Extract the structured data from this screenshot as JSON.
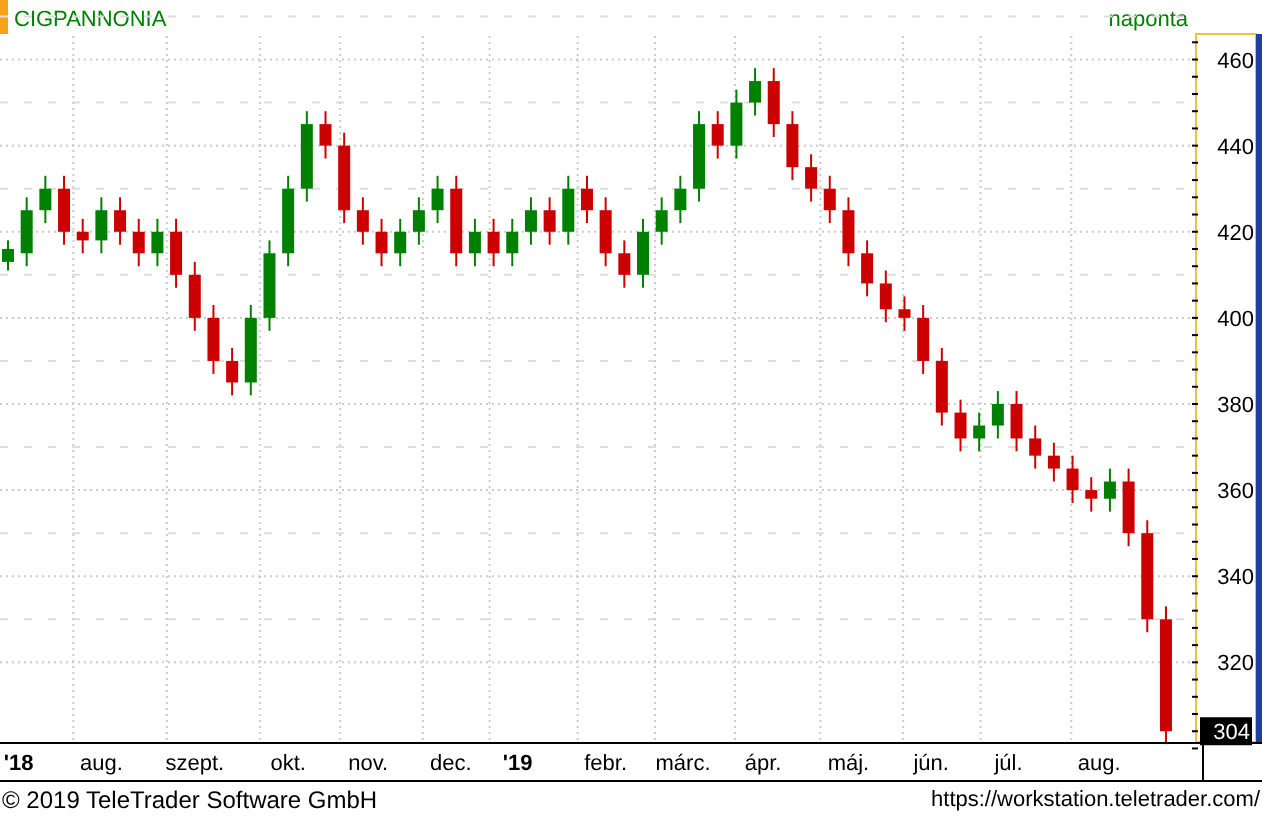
{
  "title": "CIGPANNONIA",
  "interval": "naponta",
  "chart_data": {
    "type": "candlestick",
    "grid": true,
    "xlim": [
      "2018-07-04",
      "2019-10-20"
    ],
    "ylim": [
      301.5,
      465
    ],
    "yticks": [
      {
        "value": 320,
        "label": "320"
      },
      {
        "value": 340,
        "label": "340"
      },
      {
        "value": 360,
        "label": "360"
      },
      {
        "value": 380,
        "label": "380"
      },
      {
        "value": 400,
        "label": "400"
      },
      {
        "value": 420,
        "label": "420"
      },
      {
        "value": 440,
        "label": "440"
      },
      {
        "value": 460,
        "label": "460"
      }
    ],
    "xticks": [
      {
        "value": "2018-07-11",
        "label": "'18"
      },
      {
        "value": "2018-08-11",
        "label": "aug."
      },
      {
        "value": "2018-09-15",
        "label": "szept."
      },
      {
        "value": "2018-10-20",
        "label": "okt."
      },
      {
        "value": "2018-11-19",
        "label": "nov."
      },
      {
        "value": "2018-12-20",
        "label": "dec."
      },
      {
        "value": "2019-01-14",
        "label": "'19"
      },
      {
        "value": "2019-02-16",
        "label": "febr."
      },
      {
        "value": "2019-03-17",
        "label": "márc."
      },
      {
        "value": "2019-04-16",
        "label": "ápr."
      },
      {
        "value": "2019-05-18",
        "label": "máj."
      },
      {
        "value": "2019-06-18",
        "label": "jún."
      },
      {
        "value": "2019-07-17",
        "label": "júl."
      },
      {
        "value": "2019-08-20",
        "label": "aug."
      }
    ],
    "x": [
      "2018-07-07",
      "2018-07-14",
      "2018-07-21",
      "2018-07-28",
      "2018-08-04",
      "2018-08-11",
      "2018-08-18",
      "2018-08-25",
      "2018-09-01",
      "2018-09-08",
      "2018-09-15",
      "2018-09-22",
      "2018-09-29",
      "2018-10-06",
      "2018-10-13",
      "2018-10-20",
      "2018-10-27",
      "2018-11-03",
      "2018-11-10",
      "2018-11-17",
      "2018-11-24",
      "2018-12-01",
      "2018-12-08",
      "2018-12-15",
      "2018-12-22",
      "2018-12-29",
      "2019-01-05",
      "2019-01-12",
      "2019-01-19",
      "2019-01-26",
      "2019-02-02",
      "2019-02-09",
      "2019-02-16",
      "2019-02-23",
      "2019-03-02",
      "2019-03-09",
      "2019-03-16",
      "2019-03-23",
      "2019-03-30",
      "2019-04-06",
      "2019-04-13",
      "2019-04-20",
      "2019-04-27",
      "2019-05-04",
      "2019-05-11",
      "2019-05-18",
      "2019-05-25",
      "2019-06-01",
      "2019-06-08",
      "2019-06-15",
      "2019-06-22",
      "2019-06-29",
      "2019-07-06",
      "2019-07-13",
      "2019-07-20",
      "2019-07-27",
      "2019-08-03",
      "2019-08-10",
      "2019-08-17",
      "2019-08-24",
      "2019-08-31",
      "2019-09-07",
      "2019-09-14"
    ],
    "ohlc": [
      [
        413,
        418,
        411,
        416
      ],
      [
        415,
        428,
        412,
        425
      ],
      [
        425,
        433,
        422,
        430
      ],
      [
        430,
        433,
        417,
        420
      ],
      [
        420,
        423,
        415,
        418
      ],
      [
        418,
        428,
        415,
        425
      ],
      [
        425,
        428,
        417,
        420
      ],
      [
        420,
        423,
        412,
        415
      ],
      [
        415,
        423,
        412,
        420
      ],
      [
        420,
        423,
        407,
        410
      ],
      [
        410,
        413,
        397,
        400
      ],
      [
        400,
        403,
        387,
        390
      ],
      [
        390,
        393,
        382,
        385
      ],
      [
        385,
        403,
        382,
        400
      ],
      [
        400,
        418,
        397,
        415
      ],
      [
        415,
        433,
        412,
        430
      ],
      [
        430,
        448,
        427,
        445
      ],
      [
        445,
        448,
        437,
        440
      ],
      [
        440,
        443,
        422,
        425
      ],
      [
        425,
        428,
        417,
        420
      ],
      [
        420,
        423,
        412,
        415
      ],
      [
        415,
        423,
        412,
        420
      ],
      [
        420,
        428,
        417,
        425
      ],
      [
        425,
        433,
        422,
        430
      ],
      [
        430,
        433,
        412,
        415
      ],
      [
        415,
        423,
        412,
        420
      ],
      [
        420,
        423,
        412,
        415
      ],
      [
        415,
        423,
        412,
        420
      ],
      [
        420,
        428,
        417,
        425
      ],
      [
        425,
        428,
        417,
        420
      ],
      [
        420,
        433,
        417,
        430
      ],
      [
        430,
        433,
        422,
        425
      ],
      [
        425,
        428,
        412,
        415
      ],
      [
        415,
        418,
        407,
        410
      ],
      [
        410,
        423,
        407,
        420
      ],
      [
        420,
        428,
        417,
        425
      ],
      [
        425,
        433,
        422,
        430
      ],
      [
        430,
        448,
        427,
        445
      ],
      [
        445,
        448,
        437,
        440
      ],
      [
        440,
        453,
        437,
        450
      ],
      [
        450,
        458,
        447,
        455
      ],
      [
        455,
        458,
        442,
        445
      ],
      [
        445,
        448,
        432,
        435
      ],
      [
        435,
        438,
        427,
        430
      ],
      [
        430,
        433,
        422,
        425
      ],
      [
        425,
        428,
        412,
        415
      ],
      [
        415,
        418,
        405,
        408
      ],
      [
        408,
        411,
        399,
        402
      ],
      [
        402,
        405,
        397,
        400
      ],
      [
        400,
        403,
        387,
        390
      ],
      [
        390,
        393,
        375,
        378
      ],
      [
        378,
        381,
        369,
        372
      ],
      [
        372,
        378,
        369,
        375
      ],
      [
        375,
        383,
        372,
        380
      ],
      [
        380,
        383,
        369,
        372
      ],
      [
        372,
        375,
        365,
        368
      ],
      [
        368,
        371,
        362,
        365
      ],
      [
        365,
        368,
        357,
        360
      ],
      [
        360,
        363,
        355,
        358
      ],
      [
        358,
        365,
        355,
        362
      ],
      [
        362,
        365,
        347,
        350
      ],
      [
        350,
        353,
        327,
        330
      ],
      [
        330,
        333,
        301,
        304
      ]
    ]
  },
  "last_value": "304",
  "footer": {
    "copyright": "© 2019 TeleTrader Software GmbH",
    "url": "https://workstation.teletrader.com/"
  }
}
